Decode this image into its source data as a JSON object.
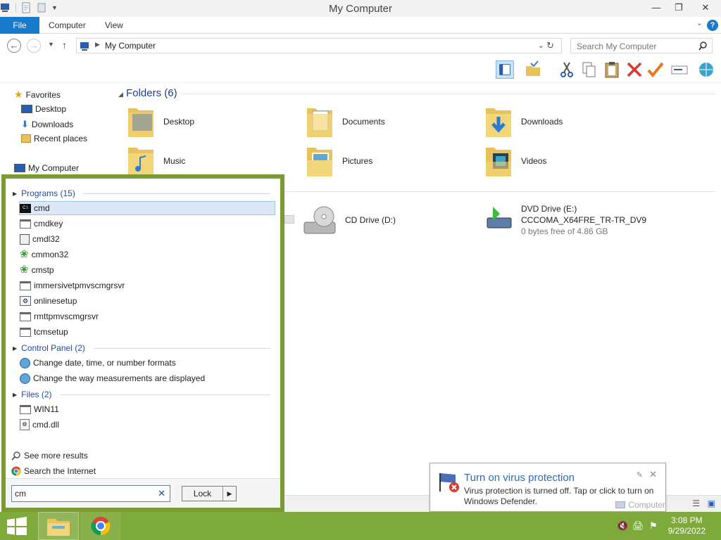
{
  "window": {
    "title": "My Computer",
    "help": "?"
  },
  "ribbon": {
    "tabs": [
      "File",
      "Computer",
      "View"
    ]
  },
  "address": {
    "path": "My Computer",
    "search_placeholder": "Search My Computer"
  },
  "nav": {
    "favorites": "Favorites",
    "items": [
      "Desktop",
      "Downloads",
      "Recent places"
    ],
    "computer": "My Computer"
  },
  "content": {
    "folders_header": "Folders (6)",
    "folders": [
      "Desktop",
      "Documents",
      "Downloads",
      "Music",
      "Pictures",
      "Videos"
    ],
    "cd_drive": "CD Drive (D:)",
    "dvd_drive": {
      "name": "DVD Drive (E:)",
      "label": "CCCOMA_X64FRE_TR-TR_DV9",
      "free": "0 bytes free of 4.86 GB"
    }
  },
  "search_panel": {
    "programs_header": "Programs (15)",
    "programs": [
      "cmd",
      "cmdkey",
      "cmdl32",
      "cmmon32",
      "cmstp",
      "immersivetpmvscmgrsvr",
      "onlinesetup",
      "rmttpmvscmgrsvr",
      "tcmsetup"
    ],
    "control_header": "Control Panel (2)",
    "control_items": [
      "Change date, time, or number formats",
      "Change the way measurements are displayed"
    ],
    "files_header": "Files (2)",
    "files": [
      "WIN11",
      "cmd.dll"
    ],
    "see_more": "See more results",
    "search_internet": "Search the Internet",
    "query": "cm",
    "lock_label": "Lock"
  },
  "notification": {
    "title": "Turn on virus protection",
    "body": "Virus protection is turned off. Tap or click to turn on Windows Defender.",
    "source": "Computer"
  },
  "taskbar": {
    "time": "3:08 PM",
    "date": "9/29/2022"
  },
  "colors": {
    "accent": "#1979ca",
    "taskbar": "#7ea93b",
    "start_border": "#7a9a34",
    "group_header": "#1e3e8a"
  }
}
